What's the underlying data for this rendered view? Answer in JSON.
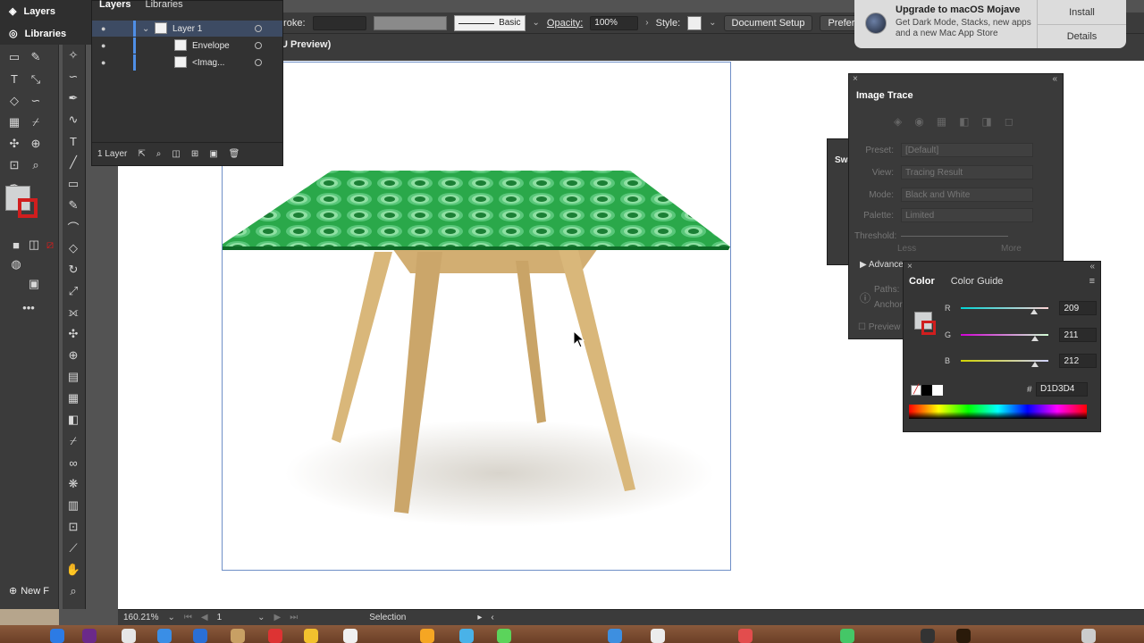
{
  "launcher": {
    "layers_label": "Layers",
    "libraries_label": "Libraries",
    "new_file_label": "New F"
  },
  "layers_panel": {
    "tabs": [
      "Layers",
      "Libraries"
    ],
    "rows": [
      {
        "name": "Layer 1"
      },
      {
        "name": "Envelope"
      },
      {
        "name": "<Imag..."
      }
    ],
    "footer": "1 Layer"
  },
  "control_bar": {
    "stroke_label": "troke:",
    "stroke_style": "Basic",
    "opacity_label": "Opacity:",
    "opacity_value": "100%",
    "style_label": "Style:",
    "doc_setup": "Document Setup",
    "prefs": "Preferen"
  },
  "document_tab": "U Preview)",
  "notification": {
    "title": "Upgrade to macOS Mojave",
    "body": "Get Dark Mode, Stacks, new apps and a new Mac App Store",
    "install": "Install",
    "details": "Details"
  },
  "image_trace": {
    "title": "Image Trace",
    "preset_label": "Preset:",
    "preset_value": "[Default]",
    "view_label": "View:",
    "view_value": "Tracing Result",
    "mode_label": "Mode:",
    "mode_value": "Black and White",
    "palette_label": "Palette:",
    "palette_value": "Limited",
    "threshold_label": "Threshold:",
    "less": "Less",
    "more": "More",
    "advanced": "Advance",
    "paths": "Paths:",
    "anchor": "Anchor",
    "preview": "Preview"
  },
  "swatches_label": "Swa",
  "color_panel": {
    "tabs": [
      "Color",
      "Color Guide"
    ],
    "channels": [
      {
        "ch": "R",
        "value": "209",
        "level": 0.82,
        "grad": "linear-gradient(to right,#00d3d4,#ffd3d4)"
      },
      {
        "ch": "G",
        "value": "211",
        "level": 0.83,
        "grad": "linear-gradient(to right,#d100d4,#d1ffd4)"
      },
      {
        "ch": "B",
        "value": "212",
        "level": 0.83,
        "grad": "linear-gradient(to right,#d1d300,#d1d3ff)"
      }
    ],
    "hex_label": "#",
    "hex": "D1D3D4"
  },
  "status_bar": {
    "zoom": "160.21%",
    "artboard": "1",
    "tool": "Selection"
  },
  "colors": {
    "tabletop": "#1f9a3e",
    "tabletop_dark": "#0e6a27",
    "wood": "#d9b77a"
  }
}
